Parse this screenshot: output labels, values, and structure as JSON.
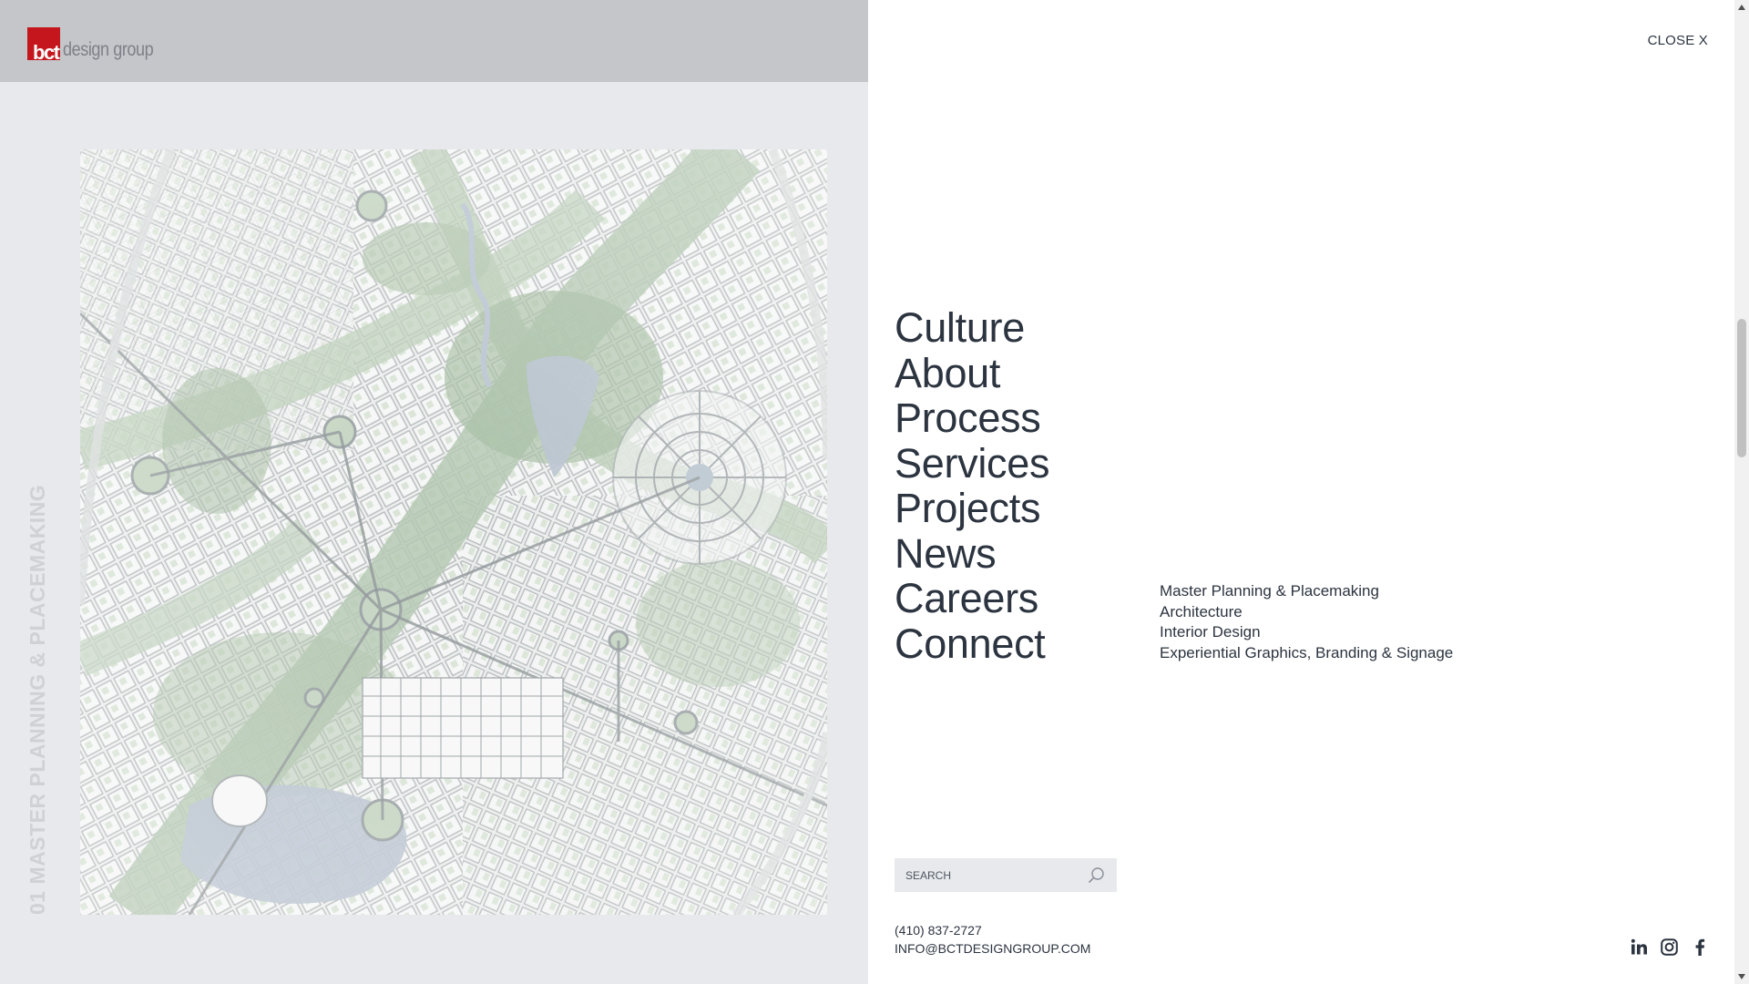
{
  "brand": {
    "logo_mark": "bct",
    "logo_text": "design group",
    "logo_color": "#c4161c"
  },
  "hero": {
    "caption": "01 MASTER PLANNING & PLACEMAKING",
    "image_alt": "aerial master plan rendering"
  },
  "menu": {
    "close_label": "CLOSE X",
    "main_items": [
      {
        "label": "Culture"
      },
      {
        "label": "About"
      },
      {
        "label": "Process"
      },
      {
        "label": "Services"
      },
      {
        "label": "Projects"
      },
      {
        "label": "News"
      },
      {
        "label": "Careers"
      },
      {
        "label": "Connect"
      }
    ],
    "sub_items": [
      {
        "label": "Master Planning & Placemaking"
      },
      {
        "label": "Architecture"
      },
      {
        "label": "Interior Design"
      },
      {
        "label": "Experiential Graphics, Branding & Signage"
      }
    ]
  },
  "search": {
    "placeholder": "SEARCH",
    "value": "",
    "icon": "search-icon"
  },
  "contact": {
    "phone": "(410) 837-2727",
    "email": "INFO@BCTDESIGNGROUP.COM"
  },
  "social": {
    "icons": [
      "linkedin-icon",
      "instagram-icon",
      "facebook-icon"
    ]
  },
  "colors": {
    "text": "#2c3440",
    "left_bg": "#e8e9ec",
    "header_bg": "#c4c6ca",
    "accent": "#c4161c"
  }
}
